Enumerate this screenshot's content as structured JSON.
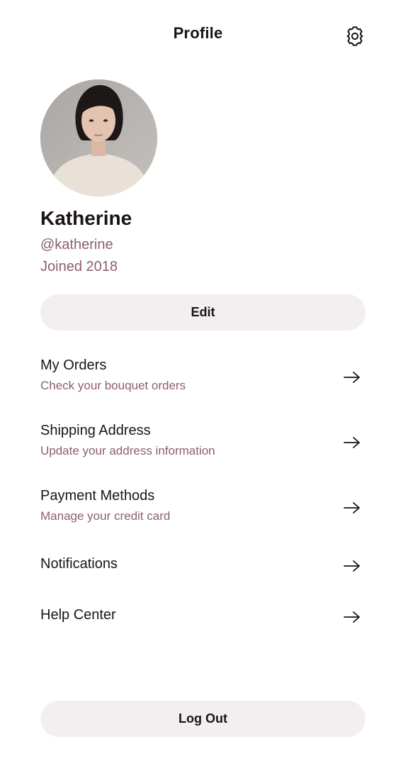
{
  "header": {
    "title": "Profile",
    "settings_icon": "gear-icon"
  },
  "profile": {
    "avatar": "profile-photo",
    "name": "Katherine",
    "handle": "@katherine",
    "joined": "Joined 2018"
  },
  "actions": {
    "edit_label": "Edit",
    "logout_label": "Log Out"
  },
  "menu": {
    "items": [
      {
        "title": "My Orders",
        "subtitle": "Check your bouquet orders",
        "icon": "arrow-right-icon"
      },
      {
        "title": "Shipping Address",
        "subtitle": "Update your address information",
        "icon": "arrow-right-icon"
      },
      {
        "title": "Payment Methods",
        "subtitle": "Manage your credit card",
        "icon": "arrow-right-icon"
      },
      {
        "title": "Notifications",
        "icon": "arrow-right-icon"
      },
      {
        "title": "Help Center",
        "icon": "arrow-right-icon"
      }
    ]
  },
  "colors": {
    "text_primary": "#1b1416",
    "text_secondary": "#8d5e6b",
    "button_background": "#f3eeef",
    "page_background": "#ffffff"
  }
}
